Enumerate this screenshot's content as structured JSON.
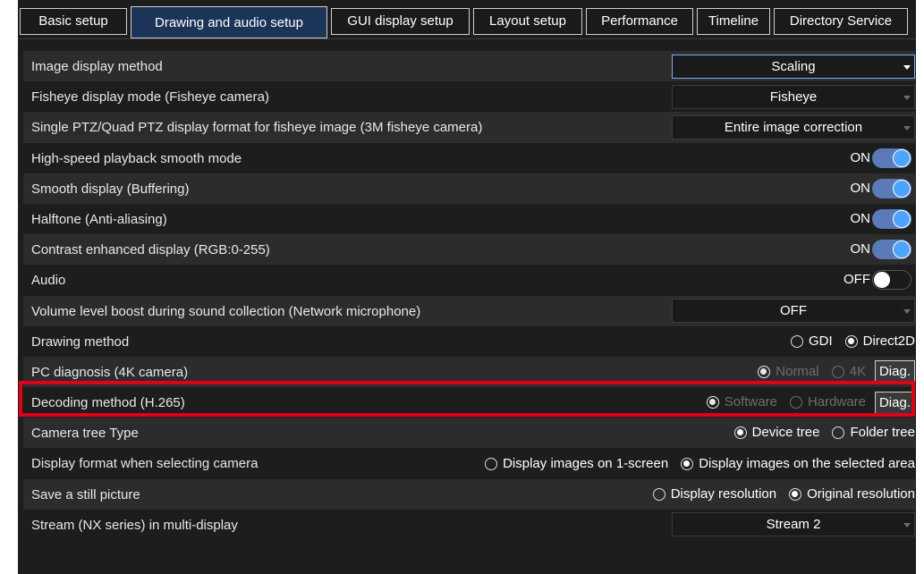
{
  "tabs": [
    {
      "label": "Basic setup",
      "active": false
    },
    {
      "label": "Drawing and audio setup",
      "active": true
    },
    {
      "label": "GUI display setup",
      "active": false
    },
    {
      "label": "Layout setup",
      "active": false
    },
    {
      "label": "Performance",
      "active": false
    },
    {
      "label": "Timeline",
      "active": false
    },
    {
      "label": "Directory Service",
      "active": false
    }
  ],
  "rows": [
    {
      "label": "Image display method",
      "control": "select",
      "value": "Scaling"
    },
    {
      "label": "Fisheye display mode (Fisheye camera)",
      "control": "select",
      "value": "Fisheye"
    },
    {
      "label": "Single PTZ/Quad PTZ display format for fisheye image (3M fisheye camera)",
      "control": "select",
      "value": "Entire image correction"
    },
    {
      "label": "High-speed playback smooth mode",
      "control": "toggle",
      "value": "ON"
    },
    {
      "label": "Smooth display (Buffering)",
      "control": "toggle",
      "value": "ON"
    },
    {
      "label": "Halftone (Anti-aliasing)",
      "control": "toggle",
      "value": "ON"
    },
    {
      "label": "Contrast enhanced display (RGB:0-255)",
      "control": "toggle",
      "value": "ON"
    },
    {
      "label": "Audio",
      "control": "toggle",
      "value": "OFF"
    },
    {
      "label": "Volume level boost during sound collection (Network microphone)",
      "control": "select",
      "value": "OFF"
    },
    {
      "label": "Drawing method",
      "control": "radio",
      "options": [
        "GDI",
        "Direct2D"
      ],
      "selected": "Direct2D"
    },
    {
      "label": "PC diagnosis (4K camera)",
      "control": "radio",
      "options": [
        "Normal",
        "4K"
      ],
      "selected": "Normal",
      "button": "Diag."
    },
    {
      "label": "Decoding method (H.265)",
      "control": "radio",
      "options": [
        "Software",
        "Hardware"
      ],
      "selected": "Software",
      "button": "Diag."
    },
    {
      "label": "Camera tree Type",
      "control": "radio",
      "options": [
        "Device tree",
        "Folder tree"
      ],
      "selected": "Device tree"
    },
    {
      "label": "Display format when selecting camera",
      "control": "radio",
      "options": [
        "Display images on 1-screen",
        "Display images on the selected area"
      ],
      "selected": "Display images on the selected area"
    },
    {
      "label": "Save a still picture",
      "control": "radio",
      "options": [
        "Display resolution",
        "Original resolution"
      ],
      "selected": "Original resolution"
    },
    {
      "label": "Stream (NX series) in multi-display",
      "control": "select",
      "value": "Stream 2"
    }
  ],
  "colors": {
    "background": "#1d1d1d",
    "row_alt": "#2c2c2c",
    "active_tab": "#1b3458",
    "toggle_on": "#4da3ff",
    "highlight": "#e0001b"
  }
}
